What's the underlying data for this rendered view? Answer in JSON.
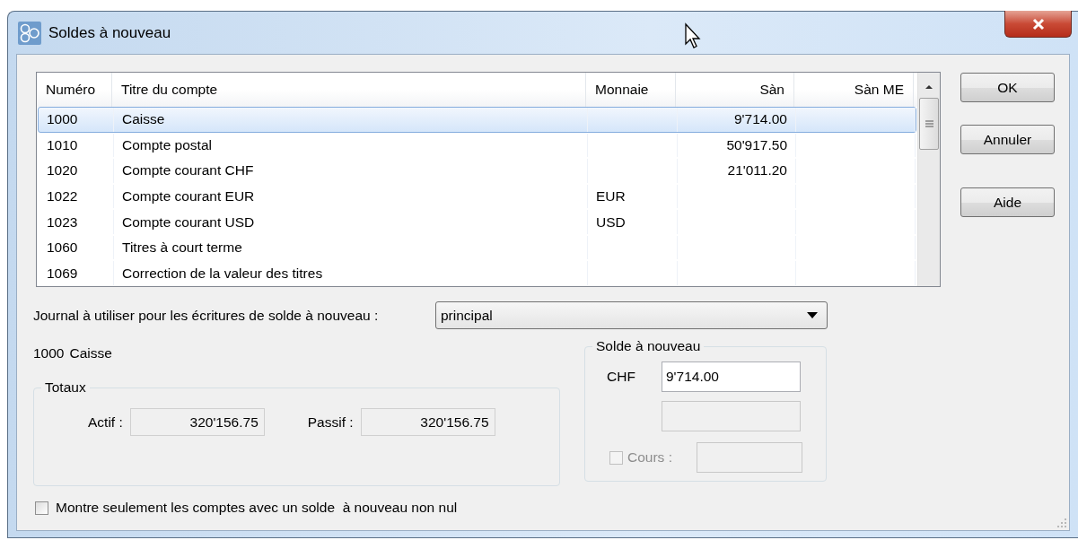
{
  "window": {
    "title": "Soldes à nouveau"
  },
  "table": {
    "columns": [
      {
        "label": "Numéro",
        "kind": "text"
      },
      {
        "label": "Titre du compte",
        "kind": "text"
      },
      {
        "label": "Monnaie",
        "kind": "text"
      },
      {
        "label": "Sàn",
        "kind": "amount"
      },
      {
        "label": "Sàn ME",
        "kind": "amount"
      }
    ],
    "rows": [
      {
        "cells": [
          "1000",
          "Caisse",
          "",
          "9'714.00",
          ""
        ],
        "selected": true
      },
      {
        "cells": [
          "1010",
          "Compte postal",
          "",
          "50'917.50",
          ""
        ],
        "selected": false
      },
      {
        "cells": [
          "1020",
          "Compte courant CHF",
          "",
          "21'011.20",
          ""
        ],
        "selected": false
      },
      {
        "cells": [
          "1022",
          "Compte courant EUR",
          "EUR",
          "",
          ""
        ],
        "selected": false
      },
      {
        "cells": [
          "1023",
          "Compte courant USD",
          "USD",
          "",
          ""
        ],
        "selected": false
      },
      {
        "cells": [
          "1060",
          "Titres à court terme",
          "",
          "",
          ""
        ],
        "selected": false
      },
      {
        "cells": [
          "1069",
          "Correction de la valeur des titres",
          "",
          "",
          ""
        ],
        "selected": false
      }
    ]
  },
  "buttons": [
    "OK",
    "Annuler",
    "Aide"
  ],
  "journal": {
    "label": "Journal à utiliser pour les écritures de solde à nouveau :",
    "value": "principal"
  },
  "account": {
    "number": "1000",
    "name": "Caisse"
  },
  "totals": {
    "title": "Totaux",
    "fields": [
      {
        "label": "Actif :",
        "value": "320'156.75"
      },
      {
        "label": "Passif :",
        "value": "320'156.75"
      }
    ]
  },
  "solde": {
    "title": "Solde à nouveau",
    "currency": "CHF",
    "value": "9'714.00",
    "cours": {
      "label": "Cours :",
      "checked": false,
      "disabled": true
    }
  },
  "filter": {
    "label": "Montre seulement les comptes avec un solde  à nouveau non nul",
    "checked": false
  }
}
